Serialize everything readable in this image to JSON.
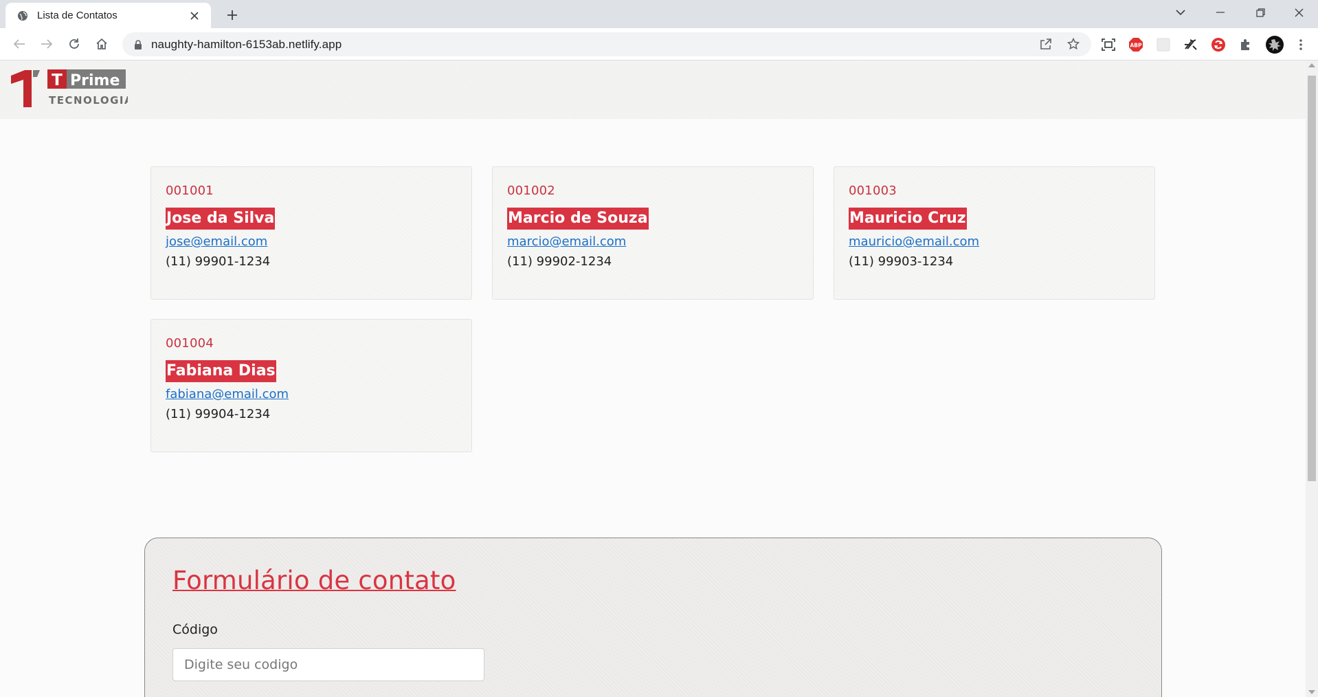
{
  "browser": {
    "tab_title": "Lista de Contatos",
    "url": "naughty-hamilton-6153ab.netlify.app"
  },
  "header": {
    "logo_letter": "T",
    "logo_word": "Prime",
    "logo_sub": "TECNOLOGIA",
    "logo_mark": "1"
  },
  "contacts": [
    {
      "code": "001001",
      "name": "Jose da Silva",
      "email": "jose@email.com",
      "phone": "(11) 99901-1234"
    },
    {
      "code": "001002",
      "name": "Marcio de Souza",
      "email": "marcio@email.com",
      "phone": "(11) 99902-1234"
    },
    {
      "code": "001003",
      "name": "Mauricio Cruz",
      "email": "mauricio@email.com",
      "phone": "(11) 99903-1234"
    },
    {
      "code": "001004",
      "name": "Fabiana Dias",
      "email": "fabiana@email.com",
      "phone": "(11) 99904-1234"
    }
  ],
  "form": {
    "title": "Formulário de contato",
    "code_label": "Código",
    "code_placeholder": "Digite seu codigo"
  },
  "colors": {
    "accent": "#d93442",
    "link": "#1a6fc9"
  }
}
